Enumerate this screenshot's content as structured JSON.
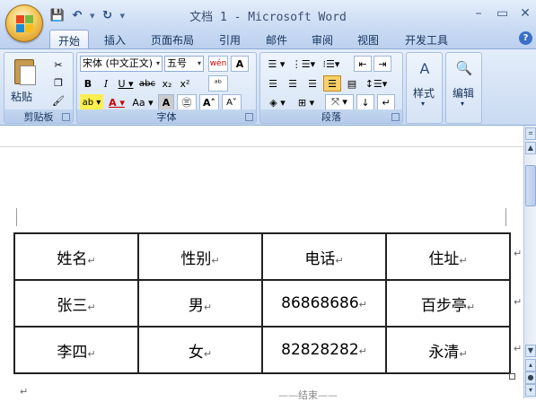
{
  "window": {
    "title": "文档 1 - Microsoft Word"
  },
  "quick_access": {
    "save": "💾",
    "undo": "↶",
    "redo": "↻"
  },
  "tabs": [
    "开始",
    "插入",
    "页面布局",
    "引用",
    "邮件",
    "审阅",
    "视图",
    "开发工具"
  ],
  "ribbon": {
    "clipboard": {
      "label": "剪贴板",
      "paste": "粘贴"
    },
    "font": {
      "label": "字体",
      "font_name": "宋体 (中文正文)",
      "font_size": "五号"
    },
    "paragraph": {
      "label": "段落"
    },
    "styles": {
      "label": "样式"
    },
    "editing": {
      "label": "编辑"
    }
  },
  "table": {
    "rows": [
      [
        "姓名",
        "性别",
        "电话",
        "住址"
      ],
      [
        "张三",
        "男",
        "86868686",
        "百步亭"
      ],
      [
        "李四",
        "女",
        "82828282",
        "永清"
      ]
    ]
  },
  "doc": {
    "trailing_text": "——结束——"
  },
  "colors": {
    "tab_bg": "#bcd0ee",
    "ribbon_bg": "#d5e3f5",
    "accent": "#15325c"
  }
}
